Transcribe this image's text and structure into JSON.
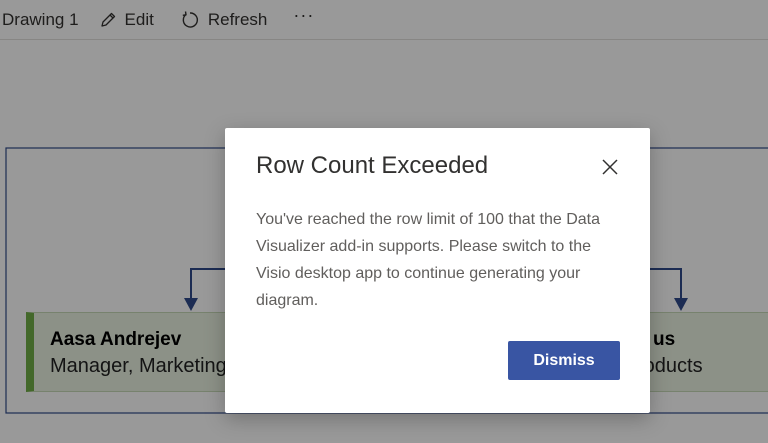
{
  "toolbar": {
    "title": "Drawing 1",
    "edit_label": "Edit",
    "refresh_label": "Refresh",
    "more_label": "···"
  },
  "diagram": {
    "left_node": {
      "name": "Aasa Andrejev",
      "role": "Manager, Marketing"
    },
    "right_node": {
      "name": "us",
      "role": "roducts"
    }
  },
  "dialog": {
    "title": "Row Count Exceeded",
    "message": "You've reached the row limit of 100 that the Data Visualizer add-in supports. Please switch to the Visio desktop app to continue generating your diagram.",
    "dismiss_label": "Dismiss"
  },
  "colors": {
    "accent": "#3955a3",
    "connector": "#2f4a8a",
    "node_fill": "#e9f2e2",
    "node_accent": "#70ad47"
  }
}
